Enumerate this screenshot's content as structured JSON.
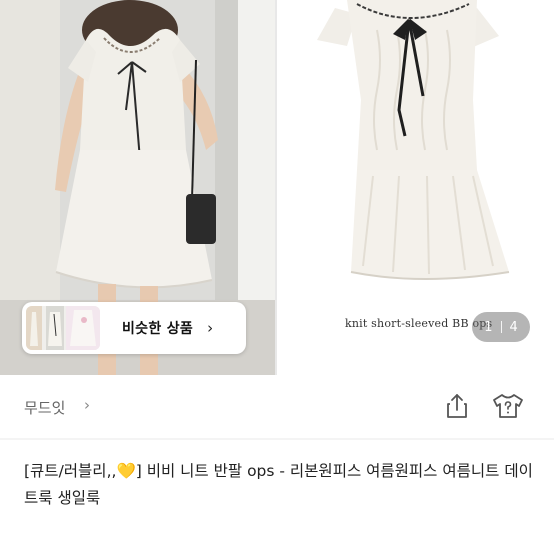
{
  "gallery": {
    "caption": "knit short-sleeved BB ops",
    "counter": {
      "current": "1",
      "total": "4"
    }
  },
  "similar": {
    "label": "비슷한 상품",
    "chevron": "›"
  },
  "seller": {
    "name": "무드잇",
    "chevron": "›"
  },
  "icons": {
    "share": "share-icon",
    "help": "t-shirt-question-icon",
    "heart": "yellow-heart"
  },
  "title": {
    "prefix": "[큐트/러블리,,",
    "heart": "💛",
    "rest": "] 비비 니트 반팔 ops - 리본원피스 여름원피스 여름니트 데이트룩 생일룩"
  },
  "colors": {
    "accent_heart": "#f2c12e",
    "text": "#222222",
    "muted": "#666666"
  }
}
